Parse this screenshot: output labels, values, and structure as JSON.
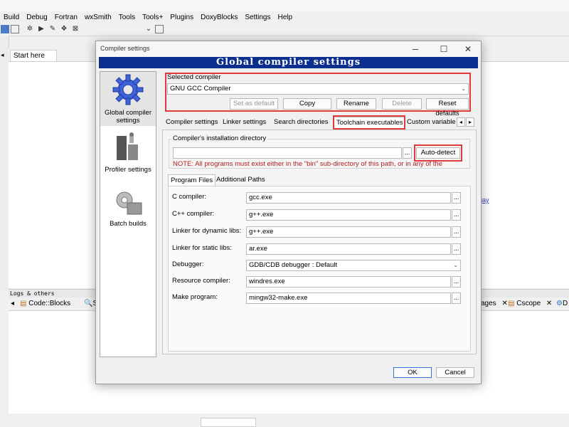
{
  "menubar": [
    "Build",
    "Debug",
    "Fortran",
    "wxSmith",
    "Tools",
    "Tools+",
    "Plugins",
    "DoxyBlocks",
    "Settings",
    "Help"
  ],
  "editor": {
    "start_tab_label": "Start here",
    "link_fragment": "jay"
  },
  "logs": {
    "header": "Logs & others",
    "tab_codeblocks": "Code::Blocks",
    "tab_s_fragment": "S",
    "tab_messages_fragment": "ages",
    "tab_cscope": "Cscope",
    "tab_d_fragment": "D"
  },
  "dialog": {
    "window_title": "Compiler settings",
    "banner_title": "Global compiler settings",
    "categories": [
      {
        "label": "Global compiler settings",
        "icon": "gear-icon",
        "selected": true
      },
      {
        "label": "Profiler settings",
        "icon": "profiler-icon",
        "selected": false
      },
      {
        "label": "Batch builds",
        "icon": "batch-builds-icon",
        "selected": false
      }
    ],
    "selected_compiler": {
      "label": "Selected compiler",
      "value": "GNU GCC Compiler",
      "buttons": {
        "set_default": "Set as default",
        "copy": "Copy",
        "rename": "Rename",
        "delete": "Delete",
        "reset": "Reset defaults"
      }
    },
    "tabs": [
      "Compiler settings",
      "Linker settings",
      "Search directories",
      "Toolchain executables",
      "Custom variable"
    ],
    "active_tab": "Toolchain executables",
    "install_dir": {
      "label": "Compiler's installation directory",
      "value": "",
      "browse": "...",
      "auto_detect": "Auto-detect",
      "note": "NOTE: All programs must exist either in the \"bin\" sub-directory of this path, or in any of the"
    },
    "subtabs": [
      "Program Files",
      "Additional Paths"
    ],
    "programs": [
      {
        "label": "C compiler:",
        "value": "gcc.exe",
        "type": "text"
      },
      {
        "label": "C++ compiler:",
        "value": "g++.exe",
        "type": "text"
      },
      {
        "label": "Linker for dynamic libs:",
        "value": "g++.exe",
        "type": "text"
      },
      {
        "label": "Linker for static libs:",
        "value": "ar.exe",
        "type": "text"
      },
      {
        "label": "Debugger:",
        "value": "GDB/CDB debugger : Default",
        "type": "select"
      },
      {
        "label": "Resource compiler:",
        "value": "windres.exe",
        "type": "text"
      },
      {
        "label": "Make program:",
        "value": "mingw32-make.exe",
        "type": "text"
      }
    ],
    "ok": "OK",
    "cancel": "Cancel"
  },
  "colors": {
    "banner_bg": "#0b2f8e",
    "highlight_border": "#e03a3a",
    "note_text": "#b02020",
    "ok_border": "#3a6fd8"
  }
}
